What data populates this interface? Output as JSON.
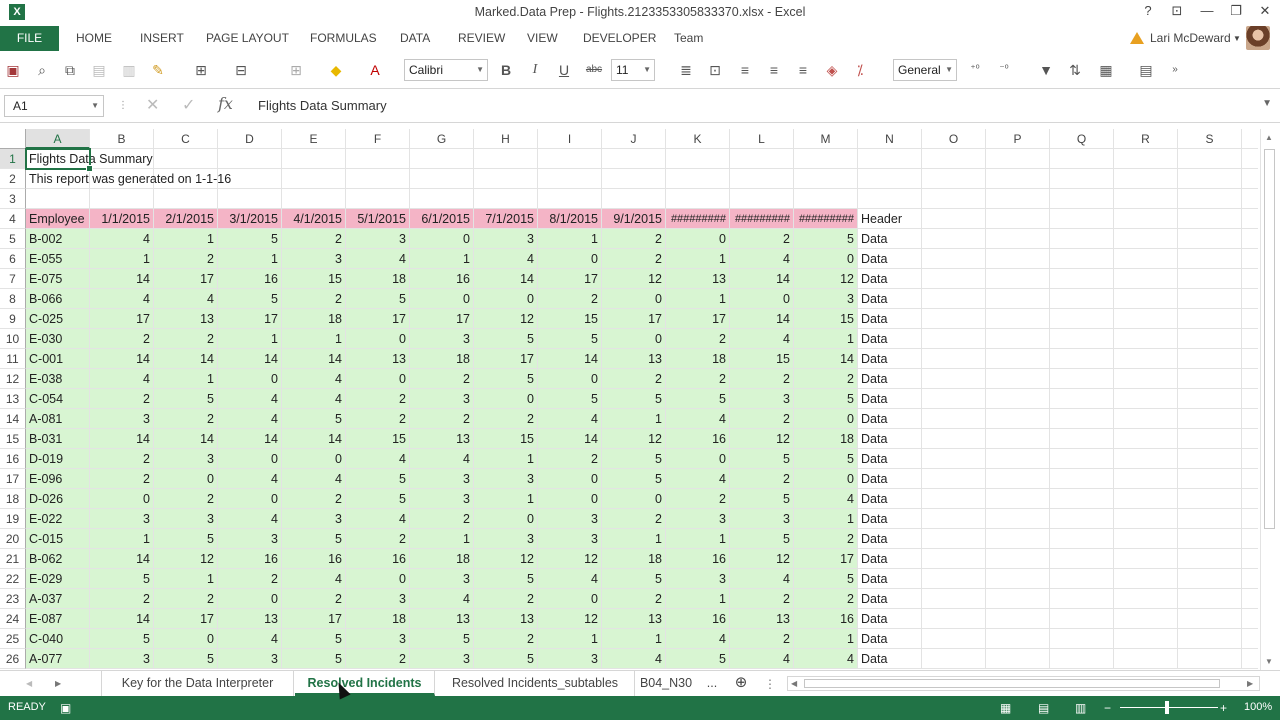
{
  "window": {
    "title": "Marked.Data Prep - Flights.2123353305833370.xlsx - Excel",
    "help": "?",
    "restore_ribbon": "⊡",
    "minimize": "—",
    "maximize": "❐",
    "close": "✕"
  },
  "ribbon": {
    "file_tab": "FILE",
    "tabs": [
      "HOME",
      "INSERT",
      "PAGE LAYOUT",
      "FORMULAS",
      "DATA",
      "REVIEW",
      "VIEW",
      "DEVELOPER",
      "Team"
    ],
    "user_name": "Lari McDeward"
  },
  "toolbar": {
    "font_name": "Calibri",
    "font_size": "11",
    "number_format": "General",
    "bold": "B",
    "italic": "I",
    "underline": "U",
    "strike": "abc"
  },
  "formula_bar": {
    "name_box": "A1",
    "fx": "fx",
    "content": "Flights Data Summary"
  },
  "grid": {
    "columns": [
      "A",
      "B",
      "C",
      "D",
      "E",
      "F",
      "G",
      "H",
      "I",
      "J",
      "K",
      "L",
      "M",
      "N",
      "O",
      "P",
      "Q",
      "R",
      "S"
    ],
    "row_numbers": [
      "1",
      "2",
      "3",
      "4",
      "5",
      "6",
      "7",
      "8",
      "9",
      "10",
      "11",
      "12",
      "13",
      "14",
      "15",
      "16",
      "17",
      "18",
      "19",
      "20",
      "21",
      "22",
      "23",
      "24",
      "25",
      "26"
    ],
    "a1": "Flights Data Summary",
    "a2": "This report was generated on 1-1-16",
    "header_row": [
      "Employee",
      "1/1/2015",
      "2/1/2015",
      "3/1/2015",
      "4/1/2015",
      "5/1/2015",
      "6/1/2015",
      "7/1/2015",
      "8/1/2015",
      "9/1/2015",
      "#########",
      "#########",
      "#########"
    ],
    "header_tag": "Header",
    "data_tag": "Data",
    "rows": [
      [
        "B-002",
        "4",
        "1",
        "5",
        "2",
        "3",
        "0",
        "3",
        "1",
        "2",
        "0",
        "2",
        "5"
      ],
      [
        "E-055",
        "1",
        "2",
        "1",
        "3",
        "4",
        "1",
        "4",
        "0",
        "2",
        "1",
        "4",
        "0"
      ],
      [
        "E-075",
        "14",
        "17",
        "16",
        "15",
        "18",
        "16",
        "14",
        "17",
        "12",
        "13",
        "14",
        "12"
      ],
      [
        "B-066",
        "4",
        "4",
        "5",
        "2",
        "5",
        "0",
        "0",
        "2",
        "0",
        "1",
        "0",
        "3"
      ],
      [
        "C-025",
        "17",
        "13",
        "17",
        "18",
        "17",
        "17",
        "12",
        "15",
        "17",
        "17",
        "14",
        "15"
      ],
      [
        "E-030",
        "2",
        "2",
        "1",
        "1",
        "0",
        "3",
        "5",
        "5",
        "0",
        "2",
        "4",
        "1"
      ],
      [
        "C-001",
        "14",
        "14",
        "14",
        "14",
        "13",
        "18",
        "17",
        "14",
        "13",
        "18",
        "15",
        "14"
      ],
      [
        "E-038",
        "4",
        "1",
        "0",
        "4",
        "0",
        "2",
        "5",
        "0",
        "2",
        "2",
        "2",
        "2"
      ],
      [
        "C-054",
        "2",
        "5",
        "4",
        "4",
        "2",
        "3",
        "0",
        "5",
        "5",
        "5",
        "3",
        "5"
      ],
      [
        "A-081",
        "3",
        "2",
        "4",
        "5",
        "2",
        "2",
        "2",
        "4",
        "1",
        "4",
        "2",
        "0"
      ],
      [
        "B-031",
        "14",
        "14",
        "14",
        "14",
        "15",
        "13",
        "15",
        "14",
        "12",
        "16",
        "12",
        "18"
      ],
      [
        "D-019",
        "2",
        "3",
        "0",
        "0",
        "4",
        "4",
        "1",
        "2",
        "5",
        "0",
        "5",
        "5"
      ],
      [
        "E-096",
        "2",
        "0",
        "4",
        "4",
        "5",
        "3",
        "3",
        "0",
        "5",
        "4",
        "2",
        "0"
      ],
      [
        "D-026",
        "0",
        "2",
        "0",
        "2",
        "5",
        "3",
        "1",
        "0",
        "0",
        "2",
        "5",
        "4"
      ],
      [
        "E-022",
        "3",
        "3",
        "4",
        "3",
        "4",
        "2",
        "0",
        "3",
        "2",
        "3",
        "3",
        "1"
      ],
      [
        "C-015",
        "1",
        "5",
        "3",
        "5",
        "2",
        "1",
        "3",
        "3",
        "1",
        "1",
        "5",
        "2"
      ],
      [
        "B-062",
        "14",
        "12",
        "16",
        "16",
        "16",
        "18",
        "12",
        "12",
        "18",
        "16",
        "12",
        "17"
      ],
      [
        "E-029",
        "5",
        "1",
        "2",
        "4",
        "0",
        "3",
        "5",
        "4",
        "5",
        "3",
        "4",
        "5"
      ],
      [
        "A-037",
        "2",
        "2",
        "0",
        "2",
        "3",
        "4",
        "2",
        "0",
        "2",
        "1",
        "2",
        "2"
      ],
      [
        "E-087",
        "14",
        "17",
        "13",
        "17",
        "18",
        "13",
        "13",
        "12",
        "13",
        "16",
        "13",
        "16"
      ],
      [
        "C-040",
        "5",
        "0",
        "4",
        "5",
        "3",
        "5",
        "2",
        "1",
        "1",
        "4",
        "2",
        "1"
      ],
      [
        "A-077",
        "3",
        "5",
        "3",
        "5",
        "2",
        "3",
        "5",
        "3",
        "4",
        "5",
        "4",
        "4"
      ]
    ]
  },
  "sheets": {
    "tabs": [
      "Key for the Data Interpreter",
      "Resolved Incidents",
      "Resolved Incidents_subtables",
      "B04_N30"
    ],
    "active": "Resolved Incidents",
    "more": "..."
  },
  "status": {
    "text": "READY",
    "zoom": "100%"
  },
  "colors": {
    "accent": "#217346",
    "header_fill": "#f4b4c6",
    "data_fill": "#d8f5d2"
  }
}
